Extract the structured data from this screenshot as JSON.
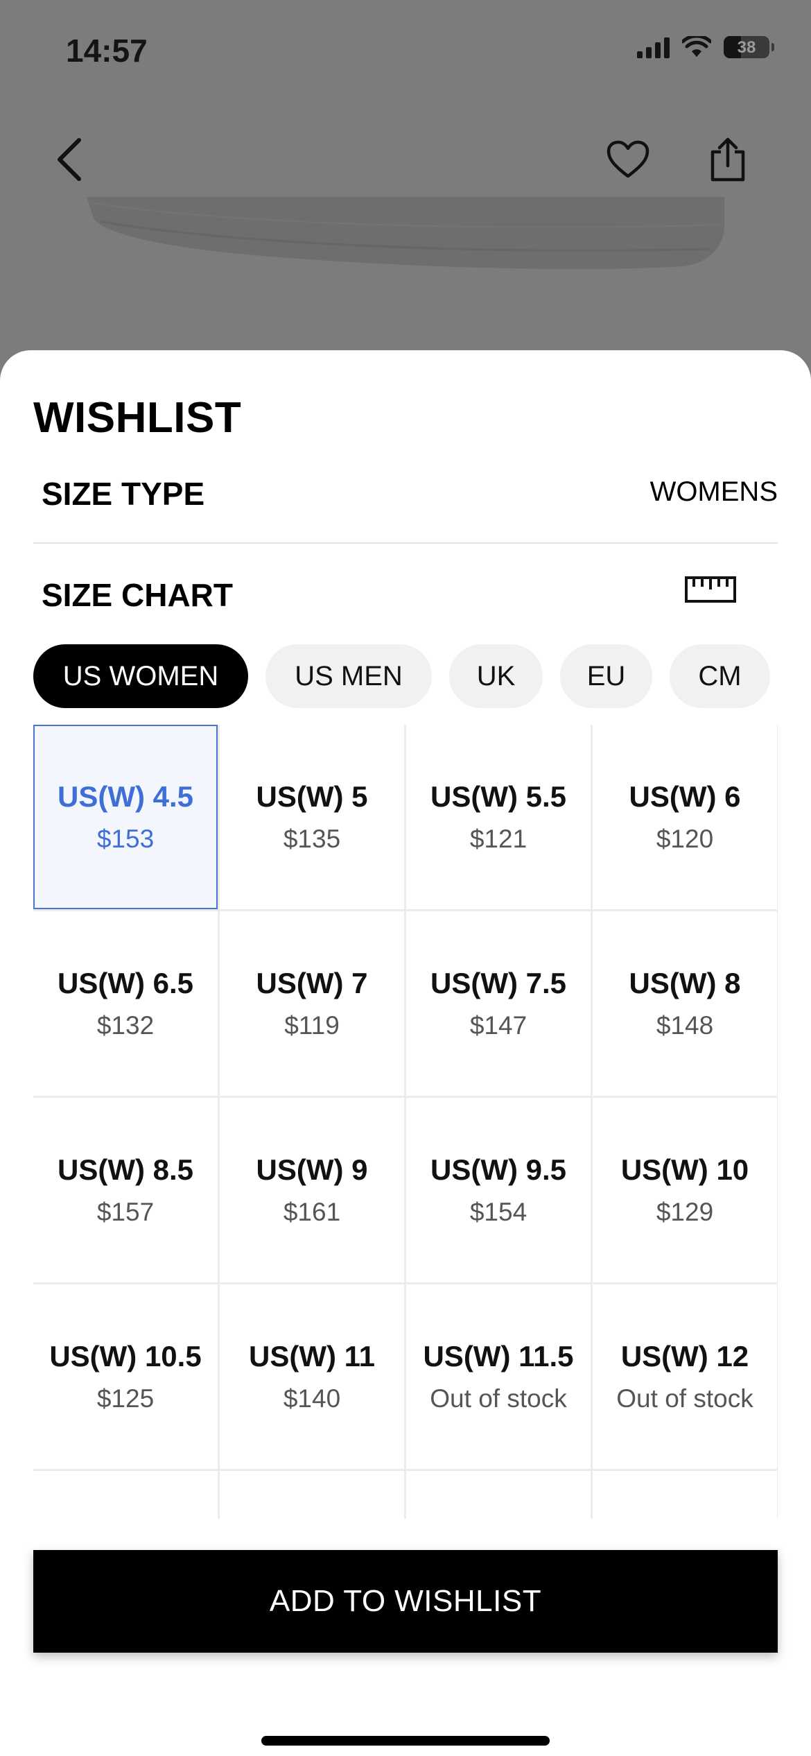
{
  "status_bar": {
    "time": "14:57",
    "battery": "38"
  },
  "sheet": {
    "title": "WISHLIST",
    "size_type_label": "SIZE TYPE",
    "size_type_value": "WOMENS",
    "size_chart_label": "SIZE CHART"
  },
  "tabs": [
    {
      "label": "US WOMEN",
      "active": true
    },
    {
      "label": "US MEN"
    },
    {
      "label": "UK"
    },
    {
      "label": "EU"
    },
    {
      "label": "CM"
    }
  ],
  "sizes": [
    {
      "size": "US(W) 4.5",
      "price": "$153",
      "selected": true
    },
    {
      "size": "US(W) 5",
      "price": "$135"
    },
    {
      "size": "US(W) 5.5",
      "price": "$121"
    },
    {
      "size": "US(W) 6",
      "price": "$120"
    },
    {
      "size": "US(W) 6.5",
      "price": "$132"
    },
    {
      "size": "US(W) 7",
      "price": "$119"
    },
    {
      "size": "US(W) 7.5",
      "price": "$147"
    },
    {
      "size": "US(W) 8",
      "price": "$148"
    },
    {
      "size": "US(W) 8.5",
      "price": "$157"
    },
    {
      "size": "US(W) 9",
      "price": "$161"
    },
    {
      "size": "US(W) 9.5",
      "price": "$154"
    },
    {
      "size": "US(W) 10",
      "price": "$129"
    },
    {
      "size": "US(W) 10.5",
      "price": "$125"
    },
    {
      "size": "US(W) 11",
      "price": "$140"
    },
    {
      "size": "US(W) 11.5",
      "price": "Out of stock"
    },
    {
      "size": "US(W) 12",
      "price": "Out of stock"
    }
  ],
  "cta": {
    "label": "ADD TO WISHLIST"
  },
  "icons": {
    "back": "chevron-left-icon",
    "wishlist": "heart-icon",
    "share": "share-icon",
    "size_chart": "ruler-icon"
  },
  "colors": {
    "accent": "#3f6fd6",
    "selected_bg": "#f3f6fc",
    "cta_bg": "#000000"
  }
}
